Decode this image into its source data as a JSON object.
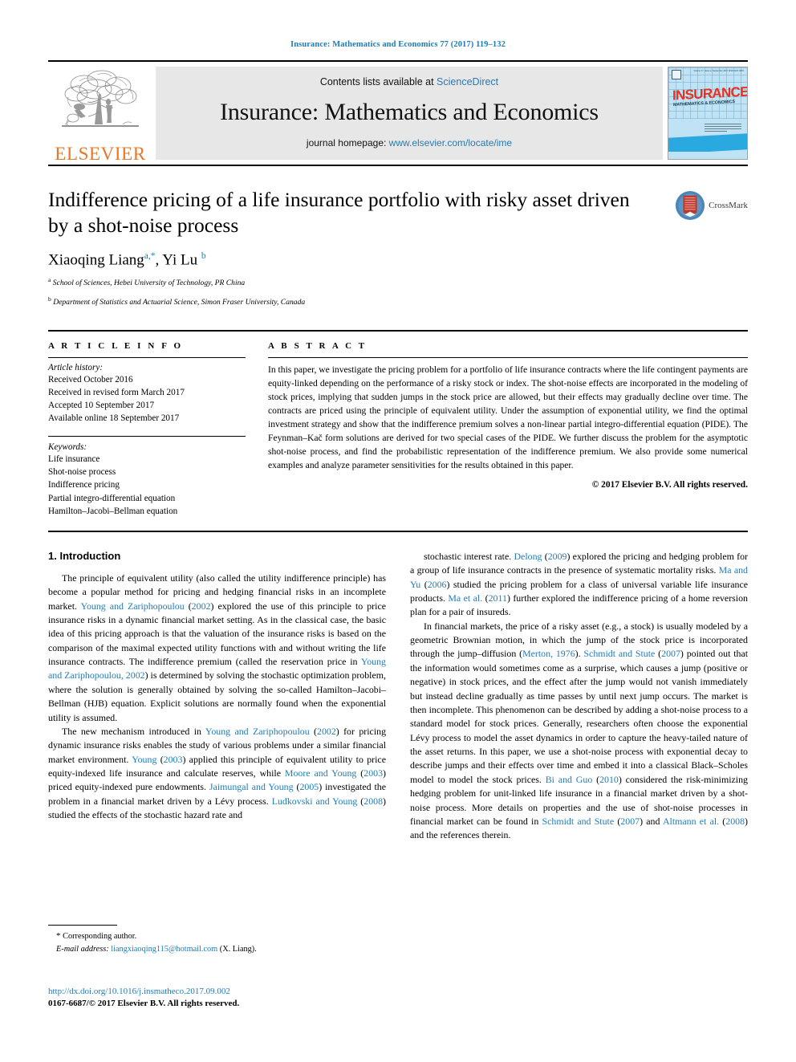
{
  "running_head": "Insurance: Mathematics and Economics 77 (2017) 119–132",
  "colors": {
    "link_blue": "#1f7bb6",
    "elsevier_orange": "#e77726",
    "banner_grey": "#e7e7e7",
    "cover_blue": "#bfe3f5",
    "cover_red": "#e8301f",
    "crossmark_blue": "#4a86b8",
    "crossmark_red": "#c0392b"
  },
  "masthead": {
    "publisher_name": "ELSEVIER",
    "publisher_logo": "elsevier-tree-logo",
    "contents_prefix": "Contents lists available at",
    "sciencedirect_link": "ScienceDirect",
    "journal_title": "Insurance: Mathematics and Economics",
    "homepage_prefix": "journal homepage:",
    "homepage_link": "www.elsevier.com/locate/ime",
    "cover": {
      "title": "INSURANCE",
      "subtitle": "MATHEMATICS & ECONOMICS",
      "top_left_mark": "elsevier-mark",
      "top_right_text": "Volume 77, Issue 2, September 2017  ISSN 0167-6687"
    }
  },
  "article": {
    "title": "Indifference pricing of a life insurance portfolio with risky asset driven by a shot-noise process",
    "authors_html": "Xiaoqing Liang<sup>a,*</sup>, Yi Lu <sup>b</sup>",
    "affiliations": [
      {
        "marker": "a",
        "text": "School of Sciences, Hebei University of Technology, PR China"
      },
      {
        "marker": "b",
        "text": "Department of Statistics and Actuarial Science, Simon Fraser University, Canada"
      }
    ],
    "crossmark_label": "CrossMark",
    "crossmark_icon": "crossmark-badge-icon"
  },
  "article_info": {
    "heading": "A R T I C L E    I N F O",
    "history_label": "Article history:",
    "history": [
      "Received October 2016",
      "Received in revised form March 2017",
      "Accepted 10 September 2017",
      "Available online 18 September 2017"
    ],
    "keywords_label": "Keywords:",
    "keywords": [
      "Life insurance",
      "Shot-noise process",
      "Indifference pricing",
      "Partial integro-differential equation",
      "Hamilton–Jacobi–Bellman equation"
    ]
  },
  "abstract": {
    "heading": "A B S T R A C T",
    "text": "In this paper, we investigate the pricing problem for a portfolio of life insurance contracts where the life contingent payments are equity-linked depending on the performance of a risky stock or index. The shot-noise effects are incorporated in the modeling of stock prices, implying that sudden jumps in the stock price are allowed, but their effects may gradually decline over time. The contracts are priced using the principle of equivalent utility. Under the assumption of exponential utility, we find the optimal investment strategy and show that the indifference premium solves a non-linear partial integro-differential equation (PIDE). The Feynman–Kač form solutions are derived for two special cases of the PIDE. We further discuss the problem for the asymptotic shot-noise process, and find the probabilistic representation of the indifference premium. We also provide some numerical examples and analyze parameter sensitivities for the results obtained in this paper.",
    "copyright": "© 2017 Elsevier B.V. All rights reserved."
  },
  "body": {
    "section_title": "1. Introduction",
    "left_paragraphs": [
      "The principle of equivalent utility (also called the utility indifference principle) has become a popular method for pricing and hedging financial risks in an incomplete market. <span class=\"cit\">Young and Zariphopoulou</span> (<span class=\"cit\">2002</span>) explored the use of this principle to price insurance risks in a dynamic financial market setting. As in the classical case, the basic idea of this pricing approach is that the valuation of the insurance risks is based on the comparison of the maximal expected utility functions with and without writing the life insurance contracts. The indifference premium (called the reservation price in <span class=\"cit\">Young and Zariphopoulou, 2002</span>) is determined by solving the stochastic optimization problem, where the solution is generally obtained by solving the so-called Hamilton–Jacobi–Bellman (HJB) equation. Explicit solutions are normally found when the exponential utility is assumed.",
      "The new mechanism introduced in <span class=\"cit\">Young and Zariphopoulou</span> (<span class=\"cit\">2002</span>) for pricing dynamic insurance risks enables the study of various problems under a similar financial market environment. <span class=\"cit\">Young</span> (<span class=\"cit\">2003</span>) applied this principle of equivalent utility to price equity-indexed life insurance and calculate reserves, while <span class=\"cit\">Moore and Young</span> (<span class=\"cit\">2003</span>) priced equity-indexed pure endowments. <span class=\"cit\">Jaimungal and Young</span> (<span class=\"cit\">2005</span>) investigated the problem in a financial market driven by a Lévy process. <span class=\"cit\">Ludkovski and Young</span> (<span class=\"cit\">2008</span>) studied the effects of the stochastic hazard rate and"
    ],
    "right_paragraphs": [
      "stochastic interest rate. <span class=\"cit\">Delong</span> (<span class=\"cit\">2009</span>) explored the pricing and hedging problem for a group of life insurance contracts in the presence of systematic mortality risks. <span class=\"cit\">Ma and Yu</span> (<span class=\"cit\">2006</span>) studied the pricing problem for a class of universal variable life insurance products. <span class=\"cit\">Ma et al.</span> (<span class=\"cit\">2011</span>) further explored the indifference pricing of a home reversion plan for a pair of insureds.",
      "In financial markets, the price of a risky asset (e.g., a stock) is usually modeled by a geometric Brownian motion, in which the jump of the stock price is incorporated through the jump–diffusion (<span class=\"cit\">Merton, 1976</span>). <span class=\"cit\">Schmidt and Stute</span> (<span class=\"cit\">2007</span>) pointed out that the information would sometimes come as a surprise, which causes a jump (positive or negative) in stock prices, and the effect after the jump would not vanish immediately but instead decline gradually as time passes by until next jump occurs. The market is then incomplete. This phenomenon can be described by adding a shot-noise process to a standard model for stock prices. Generally, researchers often choose the exponential Lévy process to model the asset dynamics in order to capture the heavy-tailed nature of the asset returns. In this paper, we use a shot-noise process with exponential decay to describe jumps and their effects over time and embed it into a classical Black–Scholes model to model the stock prices. <span class=\"cit\">Bi and Guo</span> (<span class=\"cit\">2010</span>) considered the risk-minimizing hedging problem for unit-linked life insurance in a financial market driven by a shot-noise process. More details on properties and the use of shot-noise processes in financial market can be found in <span class=\"cit\">Schmidt and Stute</span> (<span class=\"cit\">2007</span>) and <span class=\"cit\">Altmann et al.</span> (<span class=\"cit\">2008</span>) and the references therein."
    ]
  },
  "footnote": {
    "corresponding_marker": "*",
    "corresponding_text": "Corresponding author.",
    "email_label": "E-mail address:",
    "email": "liangxiaoqing115@hotmail.com",
    "email_owner": "(X. Liang)."
  },
  "imprint": {
    "doi": "http://dx.doi.org/10.1016/j.insmatheco.2017.09.002",
    "issn_line": "0167-6687/© 2017 Elsevier B.V. All rights reserved."
  }
}
